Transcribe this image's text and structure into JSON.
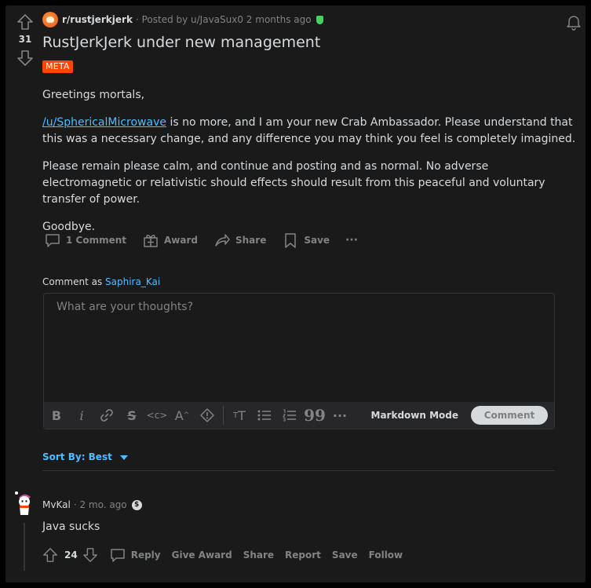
{
  "post": {
    "subreddit": "r/rustjerkjerk",
    "posted_by": "· Posted by u/JavaSux0 2 months ago",
    "score": "31",
    "title": "RustJerkJerk under new management",
    "flair": "META",
    "body": {
      "p1": "Greetings mortals,",
      "link": "/u/SphericalMicrowave",
      "p2_rest": " is no more, and I am your new Crab Ambassador. Please understand that this was a necessary change, and any difference you may think you feel is completely imagined.",
      "p3": "Please remain please calm, and continue and posting and as normal. No adverse electromagnetic or relativistic should effects should result from this peaceful and voluntary transfer of power.",
      "p4": "Goodbye."
    },
    "actions": {
      "comments": "1 Comment",
      "award": "Award",
      "share": "Share",
      "save": "Save",
      "more": "···"
    }
  },
  "composer": {
    "comment_as_prefix": "Comment as ",
    "username": "Saphira_Kai",
    "placeholder": "What are your thoughts?",
    "markdown_mode": "Markdown Mode",
    "comment_button": "Comment"
  },
  "sort": {
    "label": "Sort By: Best"
  },
  "comment": {
    "author": "MvKal",
    "time": "· 2 mo. ago",
    "badge": "$",
    "body": "Java sucks",
    "score": "24",
    "actions": {
      "reply": "Reply",
      "give_award": "Give Award",
      "share": "Share",
      "report": "Report",
      "save": "Save",
      "follow": "Follow"
    }
  }
}
